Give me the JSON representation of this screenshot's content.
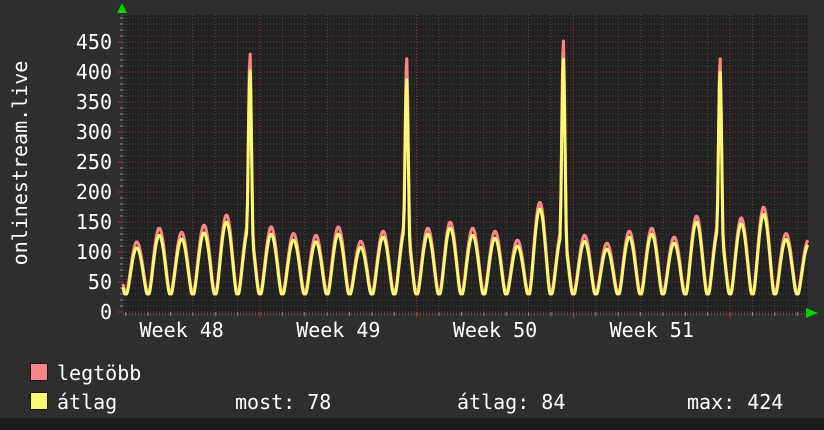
{
  "header": {
    "title": "onlinestream.live"
  },
  "colors": {
    "background": "#2e2e2e",
    "plot_background": "#222222",
    "bottom_strip": "#1b1b1b",
    "grid_minor": "#4a4a4a",
    "grid_major": "#a03434",
    "axis_dots": "#8a8a8a",
    "text": "#ffffff",
    "arrow_green": "#00d400",
    "series_max": "#f98686",
    "series_avg": "#f9f972"
  },
  "chart_data": {
    "type": "line",
    "title": "onlinestream.live",
    "ylabel": "",
    "xlabel": "",
    "ylim": [
      0,
      495
    ],
    "yticks": [
      0,
      50,
      100,
      150,
      200,
      250,
      300,
      350,
      400,
      450
    ],
    "y_minor_step": 10,
    "x_week_labels": [
      "Week 48",
      "Week 49",
      "Week 50",
      "Week 51"
    ],
    "days_visible": 30.6,
    "phase": 0.12,
    "first_week_line_day": 6.12,
    "week_length_days": 7,
    "grid": true,
    "legend_position": "bottom-left",
    "series": [
      {
        "name": "legtöbb",
        "role": "max",
        "color": "#f98686",
        "trough": 35,
        "daily_peaks": [
          117,
          140,
          133,
          145,
          162,
          150,
          142,
          131,
          128,
          142,
          118,
          135,
          150,
          140,
          150,
          140,
          135,
          120,
          183,
          140,
          128,
          115,
          135,
          140,
          125,
          160,
          150,
          157,
          175,
          131,
          120
        ],
        "spikes": [
          {
            "day": 5,
            "value": 433
          },
          {
            "day": 12,
            "value": 425
          },
          {
            "day": 19,
            "value": 455
          },
          {
            "day": 26,
            "value": 425
          }
        ]
      },
      {
        "name": "átlag",
        "role": "average",
        "color": "#f9f972",
        "trough": 30,
        "daily_peaks": [
          107,
          128,
          122,
          132,
          150,
          140,
          130,
          120,
          117,
          130,
          108,
          125,
          140,
          130,
          140,
          128,
          123,
          110,
          172,
          130,
          118,
          105,
          125,
          130,
          115,
          150,
          140,
          147,
          163,
          121,
          112
        ],
        "spikes": [
          {
            "day": 5,
            "value": 405
          },
          {
            "day": 12,
            "value": 390
          },
          {
            "day": 19,
            "value": 424
          },
          {
            "day": 26,
            "value": 402
          }
        ]
      }
    ]
  },
  "legend": {
    "items": [
      {
        "label": "legtöbb",
        "color": "#f98686"
      },
      {
        "label": "átlag",
        "color": "#f9f972"
      }
    ]
  },
  "footer": {
    "stats": [
      {
        "label": "most",
        "value": "78",
        "text": "most: 78"
      },
      {
        "label": "átlag",
        "value": "84",
        "text": "átlag: 84"
      },
      {
        "label": "max",
        "value": "424",
        "text": "max: 424"
      }
    ]
  }
}
